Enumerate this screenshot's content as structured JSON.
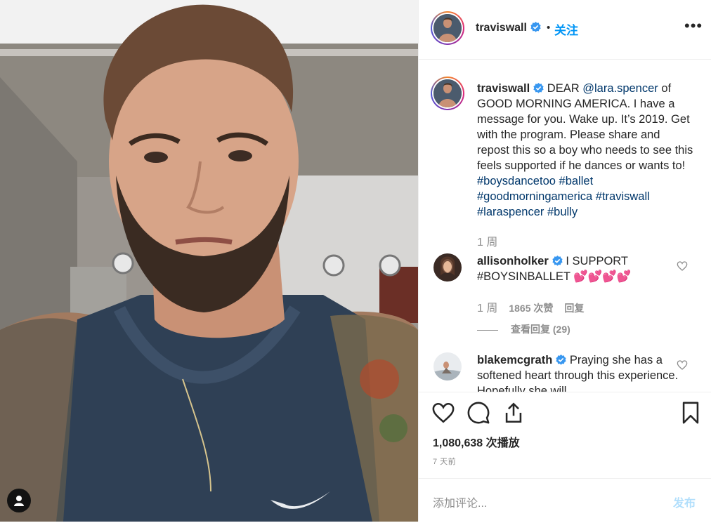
{
  "post": {
    "username": "traviswall",
    "follow_label": "关注",
    "more_label": "•••"
  },
  "caption": {
    "username": "traviswall",
    "text_before_mention": " DEAR ",
    "mention": "@lara.spencer",
    "text_main": " of GOOD MORNING AMERICA. I have a message for you. Wake up. It’s 2019. Get with the program. Please share and repost this so a boy who needs to see this feels supported if he dances or wants to! ",
    "hashtags": [
      "#boysdancetoo",
      "#ballet",
      "#goodmorningamerica",
      "#traviswall",
      "#laraspencer",
      "#bully"
    ],
    "time": "1 周"
  },
  "comments": [
    {
      "username": "allisonholker",
      "text": " I SUPPORT #BOYSINBALLET ",
      "emoji": "💕💕💕💕",
      "time": "1 周",
      "likes": "1865 次赞",
      "reply_label": "回复",
      "view_replies": "查看回复 (29)"
    },
    {
      "username": "blakemcgrath",
      "text": " Praying she has a softened heart through this experience. Hopefully she will"
    }
  ],
  "stats": {
    "plays": "1,080,638 次播放",
    "posted_ago": "7 天前"
  },
  "composer": {
    "placeholder": "添加评论...",
    "post_label": "发布"
  },
  "icons": [
    "verified-icon",
    "more-icon",
    "heart-icon",
    "comment-icon",
    "share-icon",
    "bookmark-icon",
    "user-tag-icon"
  ],
  "colors": {
    "link": "#00376b",
    "accent": "#0095f6",
    "verified": "#3897f0",
    "muted": "#8e8e8e"
  }
}
